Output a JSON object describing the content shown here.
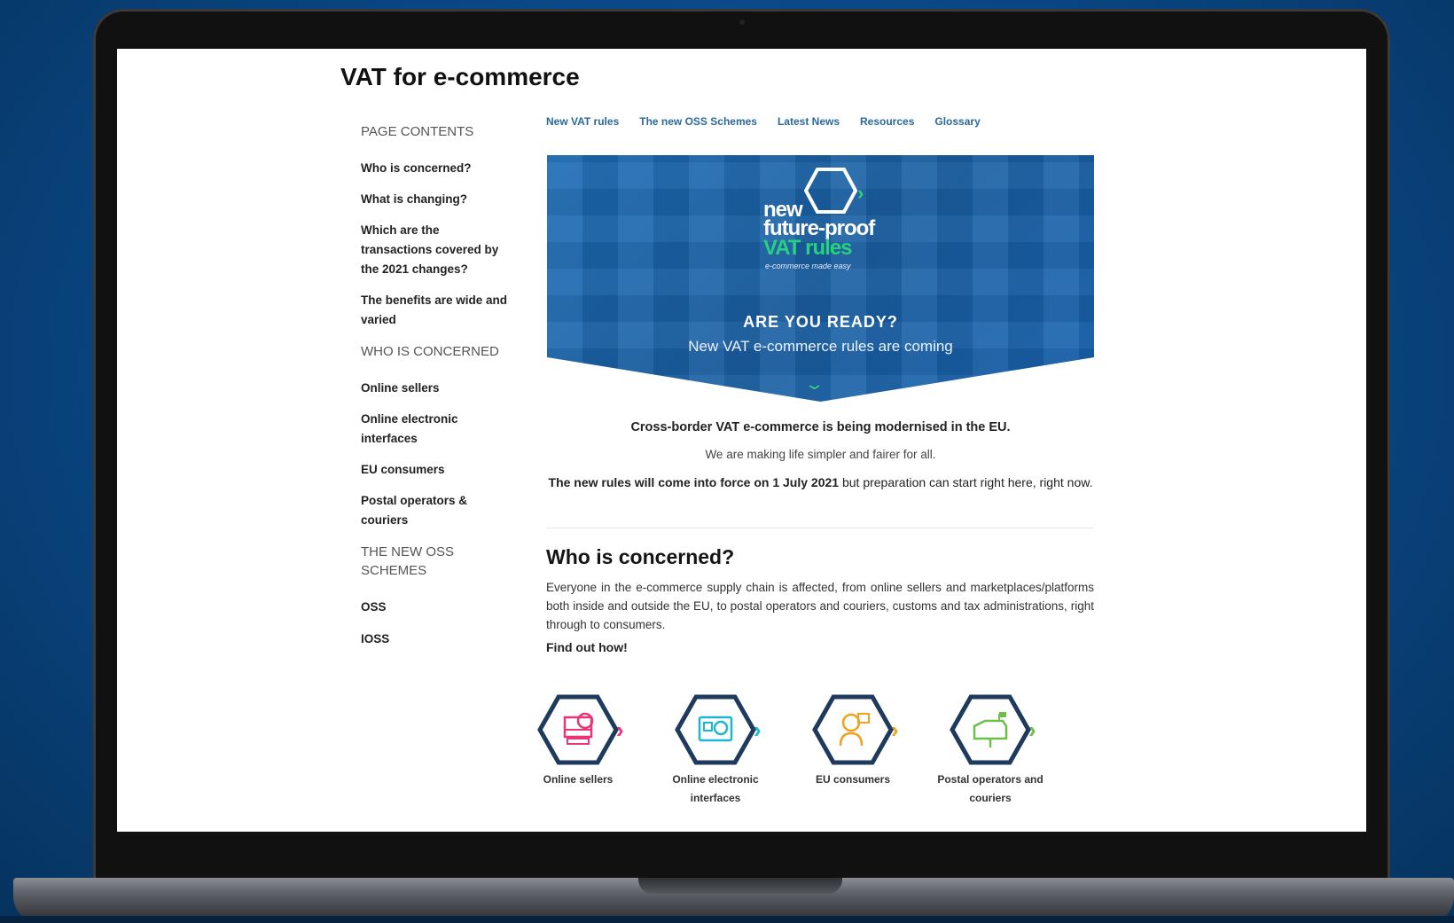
{
  "page": {
    "title": "VAT for e-commerce"
  },
  "nav": [
    {
      "label": "New VAT rules"
    },
    {
      "label": "The new OSS Schemes"
    },
    {
      "label": "Latest News"
    },
    {
      "label": "Resources"
    },
    {
      "label": "Glossary"
    }
  ],
  "sidebar": {
    "groups": [
      {
        "heading": "PAGE CONTENTS",
        "items": [
          "Who is concerned?",
          "What is changing?",
          "Which are the transactions covered by the 2021 changes?",
          "The benefits are wide and varied"
        ]
      },
      {
        "heading": "WHO IS CONCERNED",
        "items": [
          "Online sellers",
          "Online electronic interfaces",
          "EU consumers",
          "Postal operators & couriers"
        ]
      },
      {
        "heading": "THE NEW OSS SCHEMES",
        "items": [
          "OSS",
          "IOSS"
        ]
      }
    ]
  },
  "hero": {
    "line1": "new",
    "line2": "future-proof",
    "line3": "VAT rules",
    "tagline": "e-commerce made easy",
    "ready": "ARE YOU READY?",
    "coming": "New VAT e-commerce rules are coming"
  },
  "intro": {
    "line1": "Cross-border VAT e-commerce is being modernised in the EU.",
    "line2": "We are making life simpler and fairer for all.",
    "line3_a": "The new rules will come into force on ",
    "line3_date": "1 July 2021",
    "line3_b": " but preparation can start right here, right now."
  },
  "section": {
    "title": "Who is concerned?",
    "body": "Everyone in the e-commerce supply chain is affected, from online sellers and marketplaces/platforms both inside and outside the EU, to postal operators and couriers, customs and tax administrations, right through to consumers.",
    "cta": "Find out how!"
  },
  "categories": [
    {
      "label": "Online sellers",
      "icon": "online-sellers-icon",
      "color": "#e8357a"
    },
    {
      "label": "Online electronic interfaces",
      "icon": "electronic-interfaces-icon",
      "color": "#1fb6cf"
    },
    {
      "label": "EU consumers",
      "icon": "eu-consumers-icon",
      "color": "#f0a21c"
    },
    {
      "label": "Postal operators and couriers",
      "icon": "postal-operators-icon",
      "color": "#6cc04a"
    }
  ],
  "colors": {
    "hero_blue": "#1a63ac",
    "accent_green": "#2bd27f",
    "link_blue": "#2a6a9a",
    "hex_navy": "#1e3a5c"
  }
}
